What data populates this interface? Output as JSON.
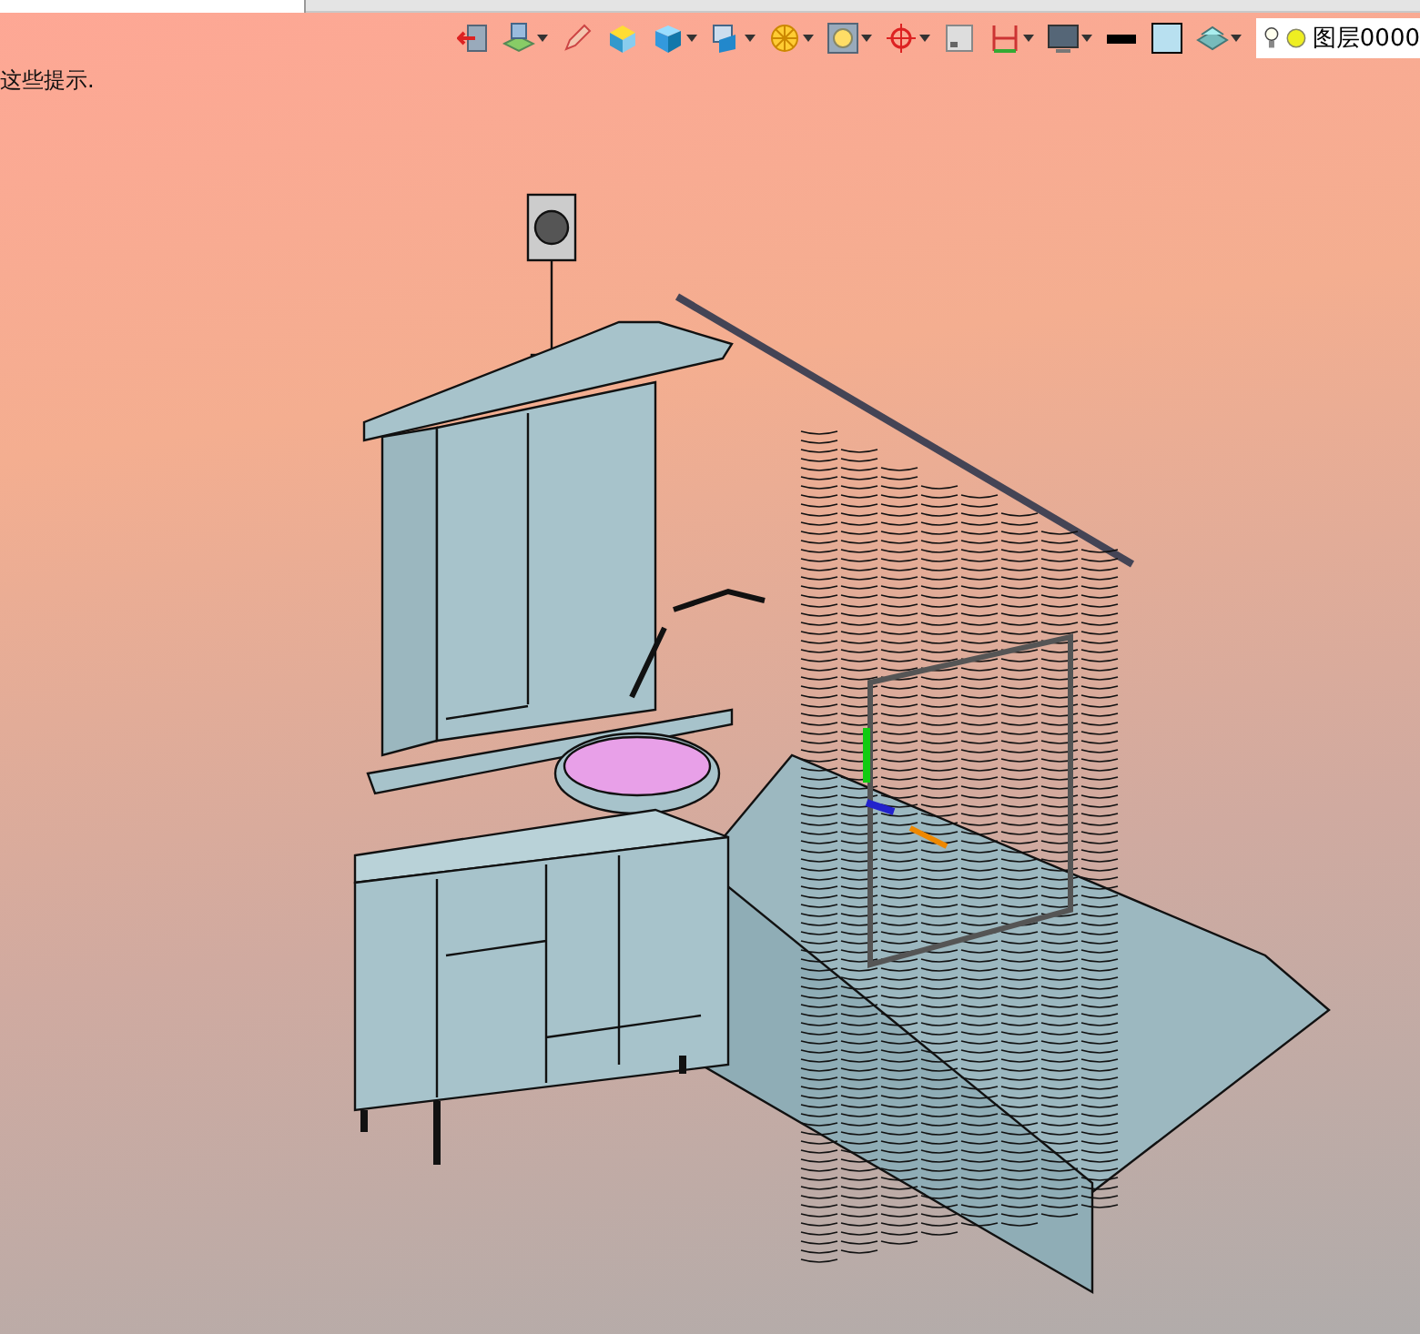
{
  "hint_text": "这些提示.",
  "layer_field": {
    "visible": true,
    "label": "图层0000"
  }
}
